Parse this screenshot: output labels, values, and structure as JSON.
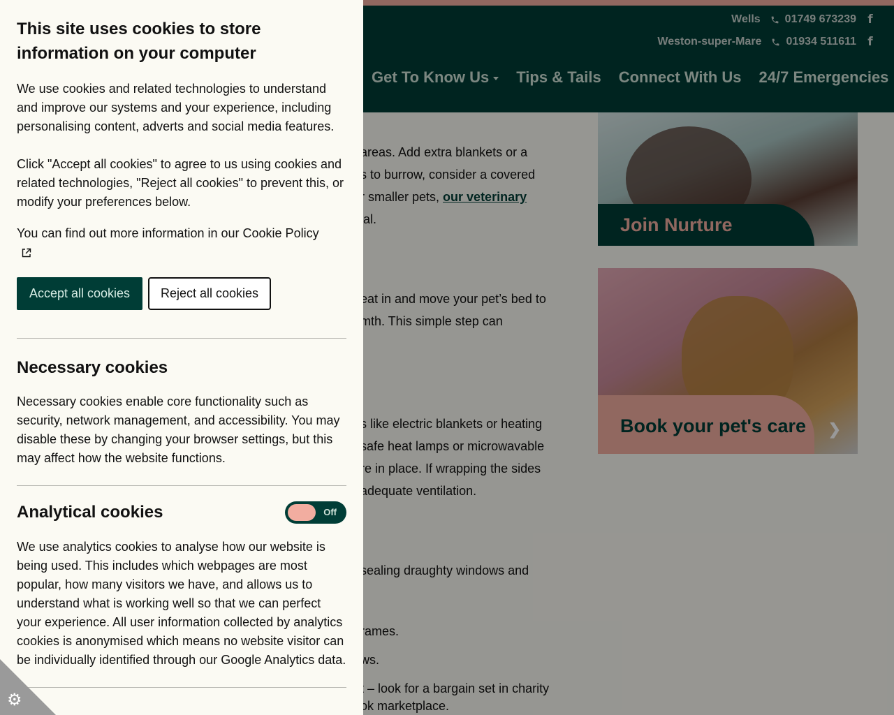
{
  "header": {
    "locations": [
      {
        "name": "Wells",
        "phone": "01749 673239"
      },
      {
        "name": "Weston-super-Mare",
        "phone": "01934 511611"
      }
    ],
    "nav": [
      "Get To Know Us",
      "Tips & Tails",
      "Connect With Us",
      "24/7 Emergencies"
    ]
  },
  "article": {
    "lines": [
      "areas. Add extra blankets or a",
      "s to burrow, consider a covered",
      "r smaller pets,",
      "ial.",
      "eat in and move your pet’s bed to",
      "mth. This simple step can",
      "s like electric blankets or heating",
      "safe heat lamps or microwavable",
      "re in place. If wrapping the sides",
      "adequate ventilation.",
      "sealing draughty windows and",
      "rames.",
      "ws.",
      "t – look for a bargain set in charity",
      "ok marketplace."
    ],
    "link": "our veterinary"
  },
  "cards": {
    "join": "Join Nurture",
    "book": "Book your pet's care"
  },
  "cookie": {
    "title": "This site uses cookies to store information on your computer",
    "intro": "We use cookies and related technologies to understand and improve our systems and your experience, including personalising content, adverts and social media features.",
    "click": "Click \"Accept all cookies\" to agree to us using cookies and related technologies, \"Reject all cookies\" to prevent this, or modify your preferences below.",
    "policy": "You can find out more information in our Cookie Policy",
    "accept": "Accept all cookies",
    "reject": "Reject all cookies",
    "necessary_title": "Necessary cookies",
    "necessary_text": "Necessary cookies enable core functionality such as security, network management, and accessibility. You may disable these by changing your browser settings, but this may affect how the website functions.",
    "analytical_title": "Analytical cookies",
    "analytical_toggle": "Off",
    "analytical_text": "We use analytics cookies to analyse how our website is being used. This includes which webpages are most popular, how many visitors we have, and allows us to understand what is working well so that we can perfect your experience. All user information collected by analytics cookies is anonymised which means no website visitor can be individually identified through our Google Analytics data."
  },
  "icons": {
    "phone": "phone-icon",
    "facebook": "facebook-icon",
    "external": "external-link-icon",
    "cookie": "cookie-settings-icon"
  },
  "colors": {
    "brand_dark": "#003d36",
    "brand_pink": "#f2ada0",
    "panel_bg": "#fbfaf3"
  }
}
